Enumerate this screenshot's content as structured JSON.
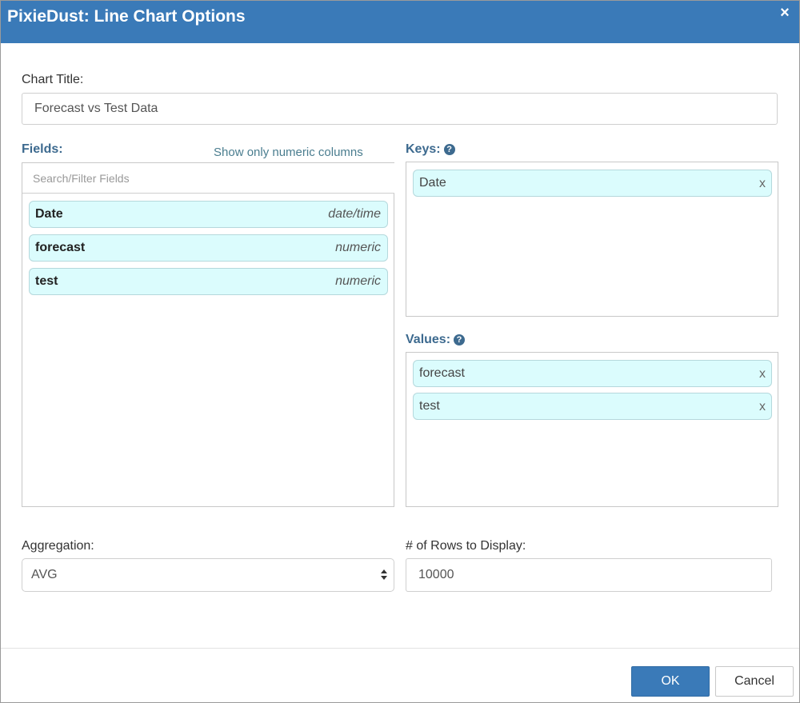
{
  "dialog": {
    "title": "PixieDust: Line Chart Options",
    "close_label": "×"
  },
  "chart_title": {
    "label": "Chart Title:",
    "value": "Forecast vs Test Data"
  },
  "fields": {
    "label": "Fields:",
    "numeric_link": "Show only numeric columns",
    "search_placeholder": "Search/Filter Fields",
    "items": [
      {
        "name": "Date",
        "type": "date/time"
      },
      {
        "name": "forecast",
        "type": "numeric"
      },
      {
        "name": "test",
        "type": "numeric"
      }
    ]
  },
  "keys": {
    "label": "Keys:",
    "help_icon": "question-circle-icon",
    "help_glyph": "?",
    "items": [
      {
        "name": "Date",
        "remove": "x"
      }
    ]
  },
  "values": {
    "label": "Values:",
    "help_icon": "question-circle-icon",
    "help_glyph": "?",
    "items": [
      {
        "name": "forecast",
        "remove": "x"
      },
      {
        "name": "test",
        "remove": "x"
      }
    ]
  },
  "aggregation": {
    "label": "Aggregation:",
    "selected": "AVG"
  },
  "rows": {
    "label": "# of Rows to Display:",
    "value": "10000"
  },
  "buttons": {
    "ok": "OK",
    "cancel": "Cancel"
  },
  "colors": {
    "header": "#3a7ab8",
    "accent_label": "#3d6a8f",
    "chip_bg": "#dbfcfd",
    "ok_button": "#3a7ab8"
  }
}
